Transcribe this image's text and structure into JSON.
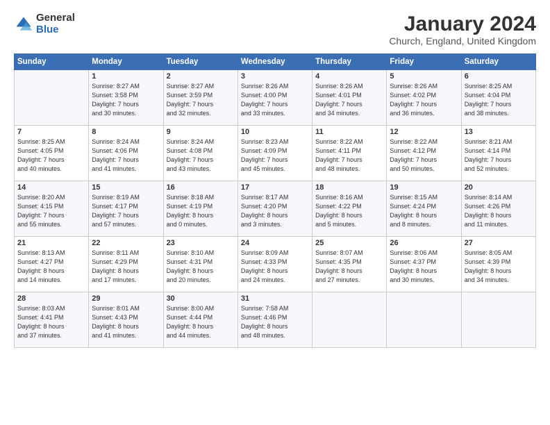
{
  "logo": {
    "general": "General",
    "blue": "Blue"
  },
  "header": {
    "title": "January 2024",
    "subtitle": "Church, England, United Kingdom"
  },
  "columns": [
    "Sunday",
    "Monday",
    "Tuesday",
    "Wednesday",
    "Thursday",
    "Friday",
    "Saturday"
  ],
  "weeks": [
    [
      {
        "day": "",
        "info": ""
      },
      {
        "day": "1",
        "info": "Sunrise: 8:27 AM\nSunset: 3:58 PM\nDaylight: 7 hours\nand 30 minutes."
      },
      {
        "day": "2",
        "info": "Sunrise: 8:27 AM\nSunset: 3:59 PM\nDaylight: 7 hours\nand 32 minutes."
      },
      {
        "day": "3",
        "info": "Sunrise: 8:26 AM\nSunset: 4:00 PM\nDaylight: 7 hours\nand 33 minutes."
      },
      {
        "day": "4",
        "info": "Sunrise: 8:26 AM\nSunset: 4:01 PM\nDaylight: 7 hours\nand 34 minutes."
      },
      {
        "day": "5",
        "info": "Sunrise: 8:26 AM\nSunset: 4:02 PM\nDaylight: 7 hours\nand 36 minutes."
      },
      {
        "day": "6",
        "info": "Sunrise: 8:25 AM\nSunset: 4:04 PM\nDaylight: 7 hours\nand 38 minutes."
      }
    ],
    [
      {
        "day": "7",
        "info": "Sunrise: 8:25 AM\nSunset: 4:05 PM\nDaylight: 7 hours\nand 40 minutes."
      },
      {
        "day": "8",
        "info": "Sunrise: 8:24 AM\nSunset: 4:06 PM\nDaylight: 7 hours\nand 41 minutes."
      },
      {
        "day": "9",
        "info": "Sunrise: 8:24 AM\nSunset: 4:08 PM\nDaylight: 7 hours\nand 43 minutes."
      },
      {
        "day": "10",
        "info": "Sunrise: 8:23 AM\nSunset: 4:09 PM\nDaylight: 7 hours\nand 45 minutes."
      },
      {
        "day": "11",
        "info": "Sunrise: 8:22 AM\nSunset: 4:11 PM\nDaylight: 7 hours\nand 48 minutes."
      },
      {
        "day": "12",
        "info": "Sunrise: 8:22 AM\nSunset: 4:12 PM\nDaylight: 7 hours\nand 50 minutes."
      },
      {
        "day": "13",
        "info": "Sunrise: 8:21 AM\nSunset: 4:14 PM\nDaylight: 7 hours\nand 52 minutes."
      }
    ],
    [
      {
        "day": "14",
        "info": "Sunrise: 8:20 AM\nSunset: 4:15 PM\nDaylight: 7 hours\nand 55 minutes."
      },
      {
        "day": "15",
        "info": "Sunrise: 8:19 AM\nSunset: 4:17 PM\nDaylight: 7 hours\nand 57 minutes."
      },
      {
        "day": "16",
        "info": "Sunrise: 8:18 AM\nSunset: 4:19 PM\nDaylight: 8 hours\nand 0 minutes."
      },
      {
        "day": "17",
        "info": "Sunrise: 8:17 AM\nSunset: 4:20 PM\nDaylight: 8 hours\nand 3 minutes."
      },
      {
        "day": "18",
        "info": "Sunrise: 8:16 AM\nSunset: 4:22 PM\nDaylight: 8 hours\nand 5 minutes."
      },
      {
        "day": "19",
        "info": "Sunrise: 8:15 AM\nSunset: 4:24 PM\nDaylight: 8 hours\nand 8 minutes."
      },
      {
        "day": "20",
        "info": "Sunrise: 8:14 AM\nSunset: 4:26 PM\nDaylight: 8 hours\nand 11 minutes."
      }
    ],
    [
      {
        "day": "21",
        "info": "Sunrise: 8:13 AM\nSunset: 4:27 PM\nDaylight: 8 hours\nand 14 minutes."
      },
      {
        "day": "22",
        "info": "Sunrise: 8:11 AM\nSunset: 4:29 PM\nDaylight: 8 hours\nand 17 minutes."
      },
      {
        "day": "23",
        "info": "Sunrise: 8:10 AM\nSunset: 4:31 PM\nDaylight: 8 hours\nand 20 minutes."
      },
      {
        "day": "24",
        "info": "Sunrise: 8:09 AM\nSunset: 4:33 PM\nDaylight: 8 hours\nand 24 minutes."
      },
      {
        "day": "25",
        "info": "Sunrise: 8:07 AM\nSunset: 4:35 PM\nDaylight: 8 hours\nand 27 minutes."
      },
      {
        "day": "26",
        "info": "Sunrise: 8:06 AM\nSunset: 4:37 PM\nDaylight: 8 hours\nand 30 minutes."
      },
      {
        "day": "27",
        "info": "Sunrise: 8:05 AM\nSunset: 4:39 PM\nDaylight: 8 hours\nand 34 minutes."
      }
    ],
    [
      {
        "day": "28",
        "info": "Sunrise: 8:03 AM\nSunset: 4:41 PM\nDaylight: 8 hours\nand 37 minutes."
      },
      {
        "day": "29",
        "info": "Sunrise: 8:01 AM\nSunset: 4:43 PM\nDaylight: 8 hours\nand 41 minutes."
      },
      {
        "day": "30",
        "info": "Sunrise: 8:00 AM\nSunset: 4:44 PM\nDaylight: 8 hours\nand 44 minutes."
      },
      {
        "day": "31",
        "info": "Sunrise: 7:58 AM\nSunset: 4:46 PM\nDaylight: 8 hours\nand 48 minutes."
      },
      {
        "day": "",
        "info": ""
      },
      {
        "day": "",
        "info": ""
      },
      {
        "day": "",
        "info": ""
      }
    ]
  ]
}
